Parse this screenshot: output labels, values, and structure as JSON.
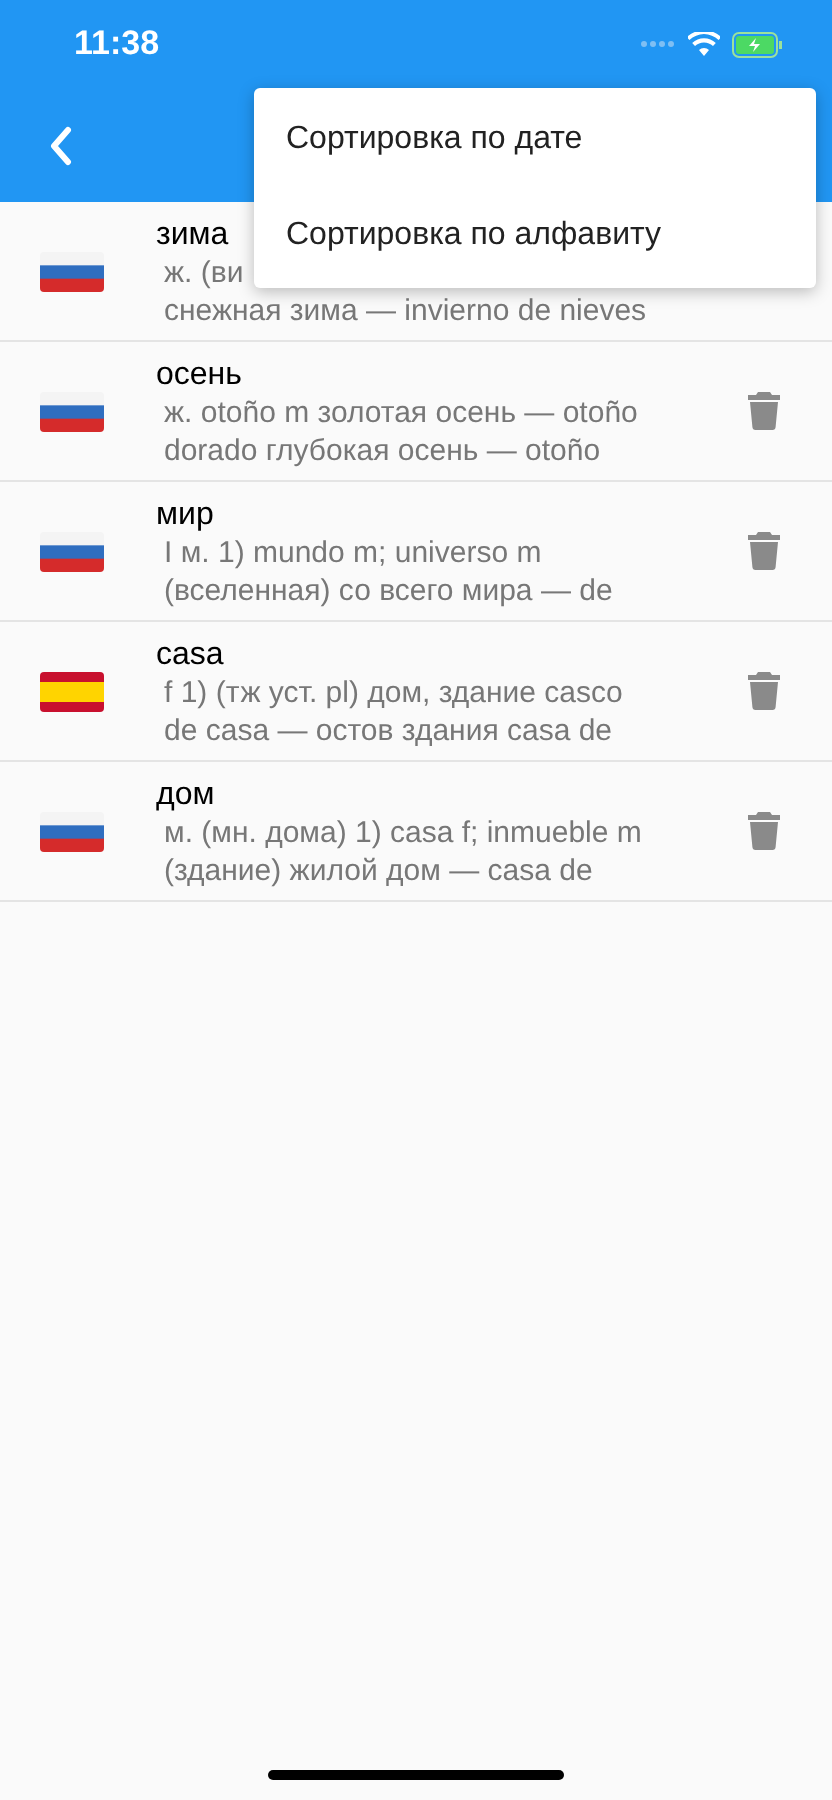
{
  "status_bar": {
    "time": "11:38"
  },
  "menu": {
    "items": [
      "Сортировка по дате",
      "Сортировка по алфавиту"
    ]
  },
  "entries": [
    {
      "word": "зима",
      "kind": "ru",
      "lines": [
        "ж. (ви",
        "снежная зима — invierno de nieves"
      ],
      "deletable": false
    },
    {
      "word": "осень",
      "kind": "ru",
      "lines": [
        "ж. otoño m золотая осень — otoño",
        "dorado глубокая осень — otoño"
      ],
      "deletable": true
    },
    {
      "word": "мир",
      "kind": "ru",
      "lines": [
        "I м. 1) mundo m; universo m",
        "(вселенная) со всего мира — de"
      ],
      "deletable": true
    },
    {
      "word": "casa",
      "kind": "es",
      "lines": [
        "f 1) (тж уст. pl) дом, здание casco",
        "de casa — остов здания casa de"
      ],
      "deletable": true
    },
    {
      "word": "дом",
      "kind": "ru",
      "lines": [
        "м. (мн. дома) 1) casa f; inmueble m",
        "(здание) жилой дом — casa de"
      ],
      "deletable": true
    }
  ]
}
